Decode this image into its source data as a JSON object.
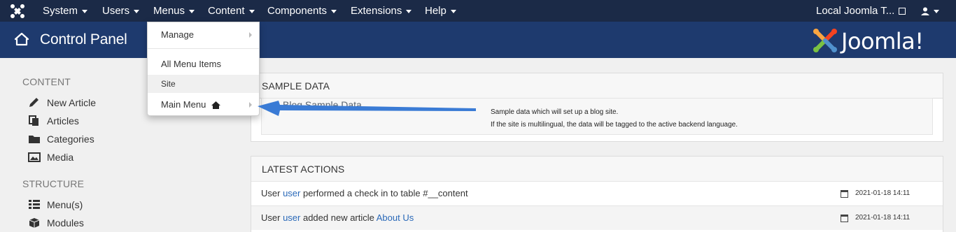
{
  "topnav": {
    "items": [
      {
        "label": "System"
      },
      {
        "label": "Users"
      },
      {
        "label": "Menus"
      },
      {
        "label": "Content"
      },
      {
        "label": "Components"
      },
      {
        "label": "Extensions"
      },
      {
        "label": "Help"
      }
    ],
    "site_link": "Local Joomla T...",
    "user_icon": "user-icon",
    "logo_icon": "joomla-logo-icon"
  },
  "header": {
    "title": "Control Panel",
    "icon": "home-icon",
    "brand": "Joomla!"
  },
  "menus_dropdown": {
    "manage": "Manage",
    "all_menu_items": "All Menu Items",
    "site": "Site",
    "main_menu": "Main Menu"
  },
  "sidebar": {
    "content_heading": "CONTENT",
    "content_items": [
      {
        "label": "New Article",
        "icon": "pencil-icon"
      },
      {
        "label": "Articles",
        "icon": "copy-icon"
      },
      {
        "label": "Categories",
        "icon": "folder-icon"
      },
      {
        "label": "Media",
        "icon": "image-icon"
      }
    ],
    "structure_heading": "STRUCTURE",
    "structure_items": [
      {
        "label": "Menu(s)",
        "icon": "list-icon"
      },
      {
        "label": "Modules",
        "icon": "cube-icon"
      }
    ]
  },
  "sample_data": {
    "heading": "Sample Data",
    "link": "Blog Sample Data",
    "desc_line1": "Sample data which will set up a blog site.",
    "desc_line2": "If the site is multilingual, the data will be tagged to the active backend language."
  },
  "latest_actions": {
    "heading": "Latest Actions",
    "rows": [
      {
        "prefix": "User ",
        "user": "user",
        "middle": " performed a check in to table #__content",
        "link": "",
        "date": "2021-01-18 14:11"
      },
      {
        "prefix": "User ",
        "user": "user",
        "middle": " added new article ",
        "link": "About Us",
        "date": "2021-01-18 14:11"
      }
    ]
  },
  "colors": {
    "topnav_bg": "#1b2a47",
    "header_bg": "#1e3a6e",
    "link": "#2a69b8",
    "arrow": "#3a7bd5"
  }
}
